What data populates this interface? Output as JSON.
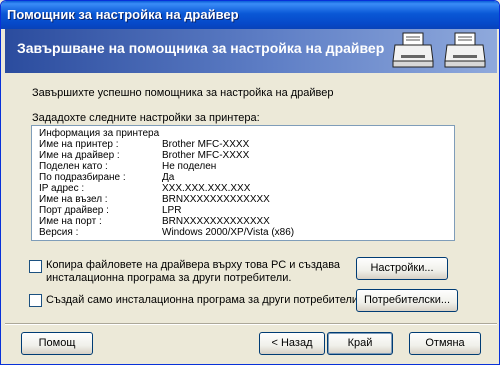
{
  "window": {
    "title": "Помощник за настройка на драйвер"
  },
  "header": {
    "title": "Завършване на помощника за настройка на драйвер",
    "icons": [
      "printer-icon",
      "printer-icon"
    ]
  },
  "main": {
    "success_text": "Завършихте успешно помощника за настройка на драйвер",
    "settings_heading": "Зададохте следните настройки за принтера:",
    "settings_list_title": "Информация за принтера",
    "settings": [
      {
        "key": "Име на принтер :",
        "value": "Brother MFC-XXXX"
      },
      {
        "key": "Име на драйвер :",
        "value": "Brother MFC-XXXX"
      },
      {
        "key": "Поделен като :",
        "value": "Не поделен"
      },
      {
        "key": "По подразбиране :",
        "value": "Да"
      },
      {
        "key": "IP адрес :",
        "value": "XXX.XXX.XXX.XXX"
      },
      {
        "key": "Име на възел :",
        "value": "BRNXXXXXXXXXXXXX"
      },
      {
        "key": "Порт драйвер :",
        "value": "LPR"
      },
      {
        "key": "Име на порт :",
        "value": "BRNXXXXXXXXXXXXX"
      },
      {
        "key": "Версия :",
        "value": "Windows 2000/XP/Vista (x86)"
      }
    ],
    "copy_checkbox": {
      "line1": "Копира файловете на драйвера върху това PC и създава",
      "line2": "инсталационна програма за други потребители.",
      "checked": false
    },
    "create_checkbox": {
      "label": "Създай само инсталационна програма за други потребители.",
      "checked": false
    },
    "settings_button": "Настройки...",
    "custom_button": "Потребителски..."
  },
  "footer": {
    "help_button": "Помощ",
    "back_button": "< Назад",
    "finish_button": "Край",
    "cancel_button": "Отмяна"
  }
}
